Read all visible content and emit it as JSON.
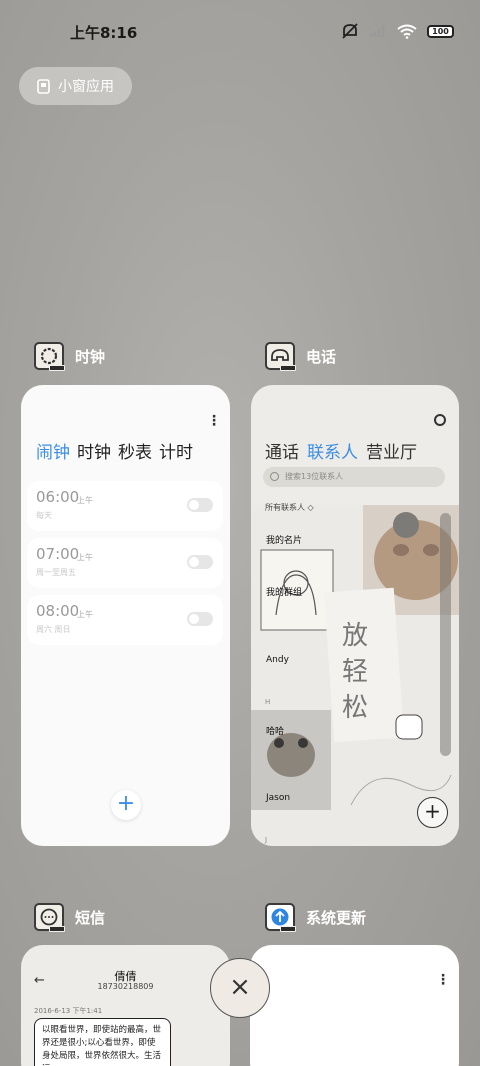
{
  "status_bar": {
    "time": "上午8:16",
    "battery": "100"
  },
  "floating_window_button": {
    "label": "小窗应用"
  },
  "apps": {
    "clock": {
      "name": "时钟",
      "tabs": [
        "闹钟",
        "时钟",
        "秒表",
        "计时"
      ],
      "active_tab": 0,
      "alarms": [
        {
          "time": "06:00",
          "ampm": "上午",
          "repeat": "每天",
          "enabled": false
        },
        {
          "time": "07:00",
          "ampm": "上午",
          "repeat": "周一至周五",
          "enabled": false
        },
        {
          "time": "08:00",
          "ampm": "上午",
          "repeat": "周六 周日",
          "enabled": false
        }
      ],
      "add_label": "+"
    },
    "phone": {
      "name": "电话",
      "tabs": [
        "通话",
        "联系人",
        "营业厅"
      ],
      "active_tab": 1,
      "search_placeholder": "搜索13位联系人",
      "filter_label": "所有联系人",
      "sections": [
        "H",
        "J"
      ],
      "contacts": [
        "我的名片",
        "我的群组",
        "Andy",
        "哈哈",
        "Jason"
      ],
      "wallpaper_text": [
        "放",
        "轻",
        "松"
      ],
      "add_label": "+"
    },
    "sms": {
      "name": "短信",
      "contact_name": "倩倩",
      "contact_number": "18730218809",
      "date": "2016-6-13 下午1:41",
      "message": "以眼看世界，即使站的最高，世界还是很小;以心看世界，即使身处局限，世界依然很大。生活远"
    },
    "update": {
      "name": "系统更新"
    }
  },
  "close_button": {
    "label": "×"
  }
}
